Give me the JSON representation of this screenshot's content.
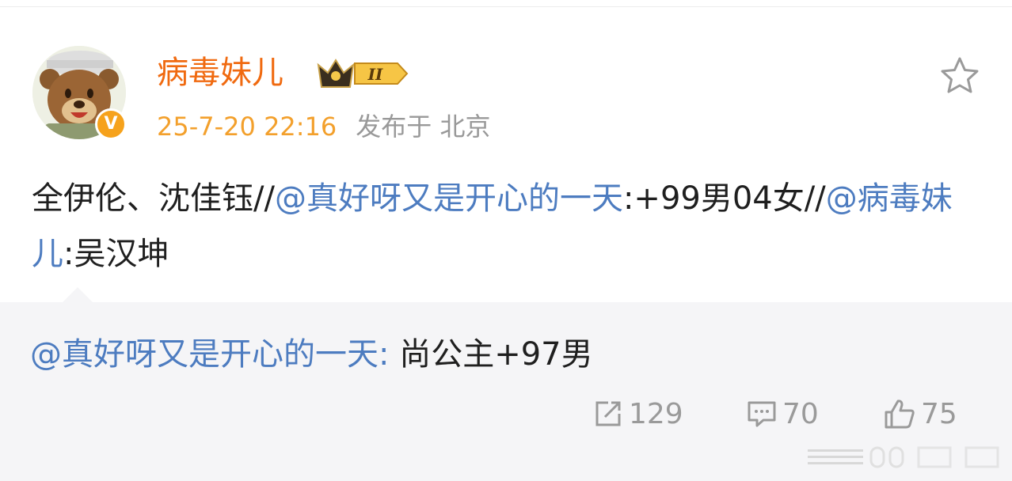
{
  "user": {
    "name": "病毒妹儿",
    "level_badge": "II",
    "time": "25-7-20 22:16",
    "source": "发布于 北京",
    "verified_mark": "V"
  },
  "post": {
    "text_1": "全伊伦、沈佳钰//",
    "mention_1": "@真好呀又是开心的一天",
    "text_2": ":+99男04女//",
    "mention_2": "@病毒妹儿",
    "text_3": ":吴汉坤"
  },
  "repost": {
    "mention": "@真好呀又是开心的一天:",
    "text": " 尚公主+97男"
  },
  "actions": {
    "repost_count": "129",
    "comment_count": "70",
    "like_count": "75"
  },
  "icons": {
    "favorite": "star-outline-icon",
    "repost": "share-arrow-icon",
    "comment": "comment-bubble-icon",
    "like": "thumbs-up-icon"
  },
  "colors": {
    "username": "#f06a10",
    "mention": "#4d7cc0",
    "time": "#f3a02c",
    "secondary": "#999999",
    "repost_bg": "#f5f5f7"
  }
}
